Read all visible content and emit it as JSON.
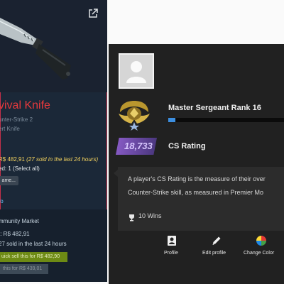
{
  "steam_panel": {
    "item_name": "vival Knife",
    "line1": "unter-Strike 2",
    "line2": "ert Knife",
    "price": "R$ 482,91",
    "sold_note": "(27 sold in the last 24 hours)",
    "selected_prefix": "ed: ",
    "selected_count": "1",
    "select_all": "(Select all)",
    "rename_label": "ame...",
    "info_link": "fo",
    "market_title": "mmunity Market",
    "market_price": "t: R$ 482,91",
    "market_sold": "27 sold in the last 24 hours",
    "quick_sell_label": "uick sell this for R$ 482,90",
    "sell_for_label": "this for R$ 439,01",
    "icons": {
      "external_link": "external-link-icon"
    },
    "colors": {
      "border": "#c5304a",
      "item_name": "#e4393c",
      "price": "#f4d35e",
      "quick_sell": "#6d8a14"
    }
  },
  "profile_panel": {
    "rank_name": "Master Sergeant Rank 16",
    "rank_progress": 0.06,
    "rating_value": "18,733",
    "rating_label": "CS Rating",
    "tooltip": {
      "line1": "A player's CS Rating is the measure of their over",
      "line2": "Counter-Strike skill, as measured in Premier Mo",
      "wins": "10 Wins"
    },
    "nav": [
      {
        "label": "Profile",
        "icon": "profile-card-icon"
      },
      {
        "label": "Edit profile",
        "icon": "pencil-icon"
      },
      {
        "label": "Change Color",
        "icon": "color-wheel-icon"
      }
    ],
    "colors": {
      "background": "#212121",
      "progress": "#3c8ee0",
      "rating_badge": "#8a5cc8"
    }
  }
}
